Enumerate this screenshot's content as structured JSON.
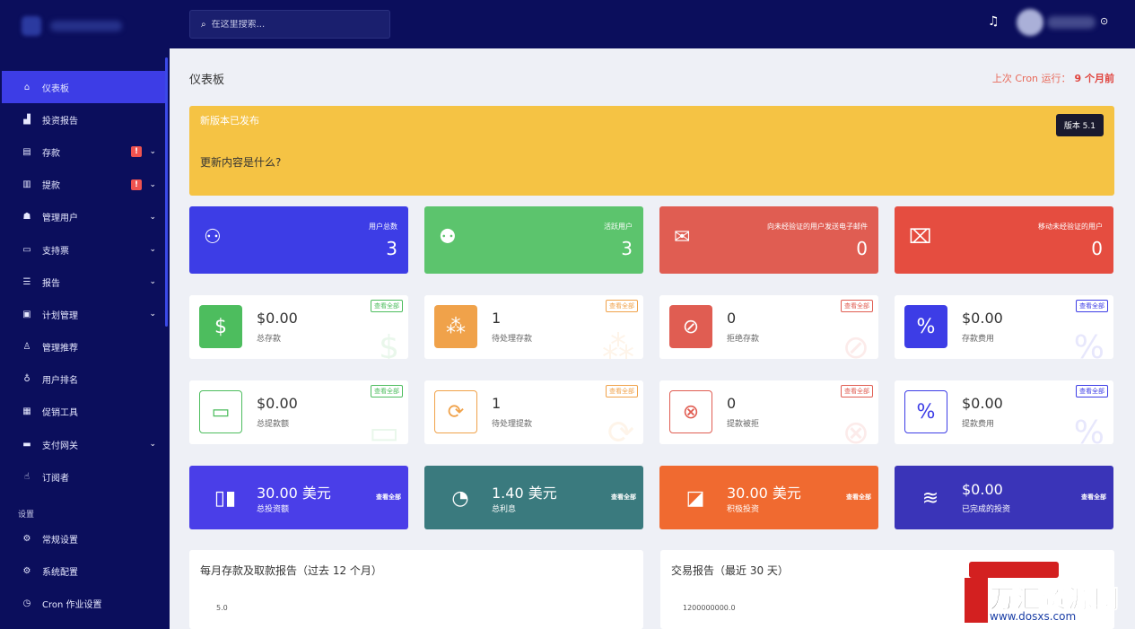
{
  "sidebar": {
    "items": [
      {
        "label": "仪表板",
        "icon": "home-icon",
        "glyph": "⌂",
        "active": true
      },
      {
        "label": "投资报告",
        "icon": "bar-chart-icon",
        "glyph": "▟"
      },
      {
        "label": "存款",
        "icon": "deposit-icon",
        "glyph": "▤",
        "badge": "!",
        "chevron": "⌄"
      },
      {
        "label": "提款",
        "icon": "bank-icon",
        "glyph": "▥",
        "badge": "!",
        "chevron": "⌄"
      },
      {
        "label": "管理用户",
        "icon": "users-icon",
        "glyph": "☗",
        "chevron": "⌄"
      },
      {
        "label": "支持票",
        "icon": "ticket-icon",
        "glyph": "▭",
        "chevron": "⌄"
      },
      {
        "label": "报告",
        "icon": "list-icon",
        "glyph": "☰",
        "chevron": "⌄"
      },
      {
        "label": "计划管理",
        "icon": "calendar-icon",
        "glyph": "▣",
        "chevron": "⌄"
      },
      {
        "label": "管理推荐",
        "icon": "referral-icon",
        "glyph": "♙"
      },
      {
        "label": "用户排名",
        "icon": "medal-icon",
        "glyph": "♁"
      },
      {
        "label": "促销工具",
        "icon": "promo-icon",
        "glyph": "▦"
      },
      {
        "label": "支付网关",
        "icon": "card-icon",
        "glyph": "▬",
        "chevron": "⌄"
      },
      {
        "label": "订阅者",
        "icon": "thumbs-up-icon",
        "glyph": "☝"
      }
    ],
    "section_label": "设置",
    "settings": [
      {
        "label": "常规设置",
        "icon": "gear-icon",
        "glyph": "⚙"
      },
      {
        "label": "系统配置",
        "icon": "cog-icon",
        "glyph": "⚙"
      },
      {
        "label": "Cron 作业设置",
        "icon": "clock-icon",
        "glyph": "◷"
      }
    ]
  },
  "topbar": {
    "search_placeholder": "在这里搜索...",
    "search_glyph": "⌕",
    "bell_glyph": "♫",
    "caret_glyph": "⊙"
  },
  "page": {
    "title": "仪表板",
    "cron_label": "上次 Cron 运行：",
    "cron_value": "9 个月前"
  },
  "banner": {
    "title": "新版本已发布",
    "question": "更新内容是什么?",
    "version": "版本 5.1",
    "color": "#f5c344"
  },
  "row1": [
    {
      "label": "用户总数",
      "value": "3",
      "color": "#3d3de6",
      "icon": "users-group-icon",
      "glyph": "⚇"
    },
    {
      "label": "活跃用户",
      "value": "3",
      "color": "#5cc46d",
      "icon": "user-check-icon",
      "glyph": "⚉"
    },
    {
      "label": "向未经验证的用户发送电子邮件",
      "value": "0",
      "color": "#e05d52",
      "icon": "envelope-icon",
      "glyph": "✉"
    },
    {
      "label": "移动未经验证的用户",
      "value": "0",
      "color": "#e54d40",
      "icon": "message-slash-icon",
      "glyph": "⌧"
    }
  ],
  "row2": [
    {
      "value": "$0.00",
      "label": "总存款",
      "view_all": "查看全部",
      "color": "#4dbd5e",
      "icon": "money-hand-icon",
      "glyph": "$",
      "outline": false
    },
    {
      "value": "1",
      "label": "待处理存款",
      "view_all": "查看全部",
      "color": "#f0a24a",
      "icon": "spinner-icon",
      "glyph": "⁂",
      "outline": false
    },
    {
      "value": "0",
      "label": "拒绝存款",
      "view_all": "查看全部",
      "color": "#e05d52",
      "icon": "ban-icon",
      "glyph": "⊘",
      "outline": false
    },
    {
      "value": "$0.00",
      "label": "存款费用",
      "view_all": "查看全部",
      "color": "#3d3de6",
      "icon": "percent-icon",
      "glyph": "%",
      "outline": false
    }
  ],
  "row3": [
    {
      "value": "$0.00",
      "label": "总提款额",
      "view_all": "查看全部",
      "color": "#4dbd5e",
      "icon": "credit-card-icon",
      "glyph": "▭",
      "outline": true
    },
    {
      "value": "1",
      "label": "待处理提款",
      "view_all": "查看全部",
      "color": "#f0a24a",
      "icon": "sync-icon",
      "glyph": "⟳",
      "outline": true
    },
    {
      "value": "0",
      "label": "提款被拒",
      "view_all": "查看全部",
      "color": "#e05d52",
      "icon": "times-circle-icon",
      "glyph": "⊗",
      "outline": true
    },
    {
      "value": "$0.00",
      "label": "提款费用",
      "view_all": "查看全部",
      "color": "#3d3de6",
      "icon": "percent-icon",
      "glyph": "%",
      "outline": true
    }
  ],
  "row4": [
    {
      "value": "30.00 美元",
      "label": "总投资额",
      "view_all": "查看全部",
      "color": "#4a3ee8",
      "icon": "bar-chart-icon",
      "glyph": "▯▮"
    },
    {
      "value": "1.40 美元",
      "label": "总利息",
      "view_all": "查看全部",
      "color": "#3a7a7e",
      "icon": "pie-chart-icon",
      "glyph": "◔"
    },
    {
      "value": "30.00 美元",
      "label": "积极投资",
      "view_all": "查看全部",
      "color": "#f06a30",
      "icon": "area-chart-icon",
      "glyph": "◪"
    },
    {
      "value": "$0.00",
      "label": "已完成的投资",
      "view_all": "查看全部",
      "color": "#3a34b8",
      "icon": "wave-icon",
      "glyph": "≋"
    }
  ],
  "panels": [
    {
      "title": "每月存款及取款报告（过去 12 个月）",
      "tick": "5.0"
    },
    {
      "title": "交易报告（最近 30 天）",
      "tick": "1200000000.0"
    }
  ],
  "watermark": {
    "title": "万汇资源网",
    "url": "www.dosxs.com"
  }
}
